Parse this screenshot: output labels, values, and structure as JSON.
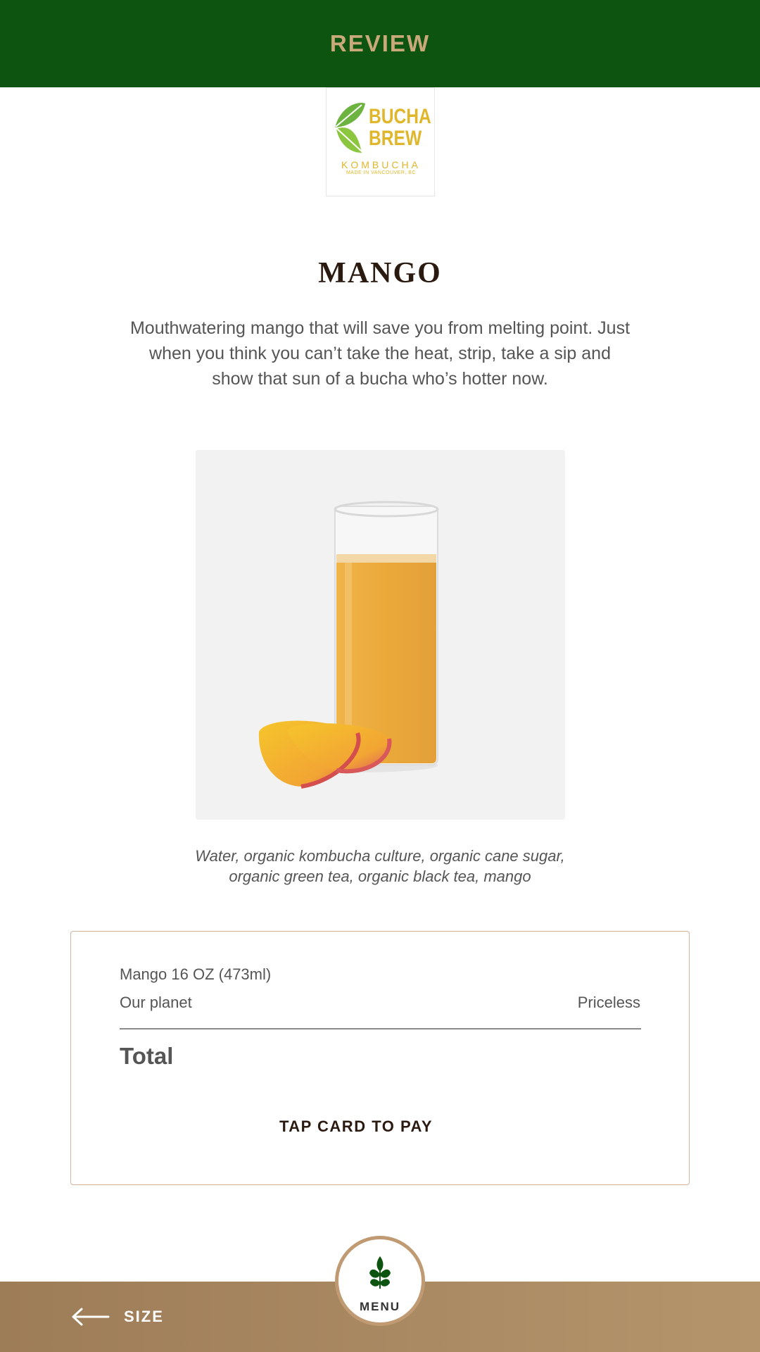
{
  "header": {
    "title": "REVIEW"
  },
  "logo": {
    "line1": "BUCHA",
    "line2": "BREW",
    "sub": "KOMBUCHA",
    "tagline": "MADE IN VANCOUVER, BC"
  },
  "product": {
    "name": "MANGO",
    "description": "Mouthwatering mango that will save you from melting point. Just when you think you can’t take the heat, strip, take a sip and show that sun of a bucha who’s hotter now.",
    "ingredients": "Water, organic kombucha culture, organic cane sugar, organic green tea, organic black tea, mango"
  },
  "order": {
    "line_item": "Mango 16 OZ (473ml)",
    "planet_label": "Our planet",
    "planet_price": "Priceless",
    "total_label": "Total",
    "pay_label": "TAP CARD TO PAY"
  },
  "footer": {
    "back_label": "SIZE",
    "menu_label": "MENU"
  },
  "colors": {
    "header_bg": "#0e5411",
    "accent_gold": "#c9a87a",
    "footer_brown": "#a88a62",
    "card_border": "#d2b49a"
  }
}
